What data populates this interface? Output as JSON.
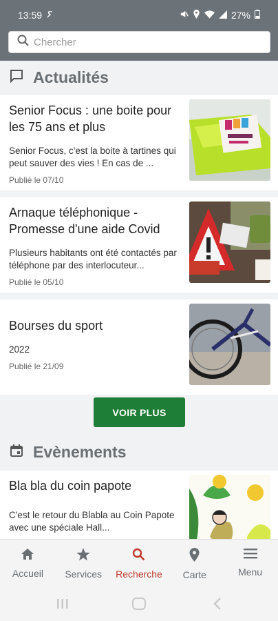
{
  "status": {
    "time": "13:59",
    "battery": "27%"
  },
  "search": {
    "placeholder": "Chercher"
  },
  "news": {
    "heading": "Actualités",
    "items": [
      {
        "title": "Senior Focus : une boite pour les 75 ans et plus",
        "excerpt": "Senior Focus, c'est la boite à tartines qui peut sauver des vies ! En cas de ...",
        "date": "Publié le 07/10",
        "image": "green-lunchbox-photo"
      },
      {
        "title": "Arnaque téléphonique - Promesse d'une aide Covid",
        "excerpt": "Plusieurs habitants ont été contactés par téléphone par des interlocuteur...",
        "date": "Publié le 05/10",
        "image": "warning-sign-photo"
      },
      {
        "title": "Bourses du sport",
        "excerpt": "2022",
        "date": "Publié le 21/09",
        "image": "bicycle-photo"
      }
    ],
    "more_button": "VOIR PLUS"
  },
  "events": {
    "heading": "Evènements",
    "items": [
      {
        "title": "Bla bla du coin papote",
        "excerpt": "C'est le retour du Blabla au Coin Papote avec une spéciale Hall...",
        "image": "illustration-blabla"
      }
    ]
  },
  "bottom_nav": [
    {
      "label": "Accueil",
      "icon": "home-icon"
    },
    {
      "label": "Services",
      "icon": "star-icon"
    },
    {
      "label": "Recherche",
      "icon": "search-icon",
      "active": true
    },
    {
      "label": "Carte",
      "icon": "map-pin-icon"
    },
    {
      "label": "Menu",
      "icon": "menu-icon"
    }
  ],
  "colors": {
    "accent": "#1e7d36",
    "header": "#6b7278",
    "active_nav": "#c0392b"
  }
}
